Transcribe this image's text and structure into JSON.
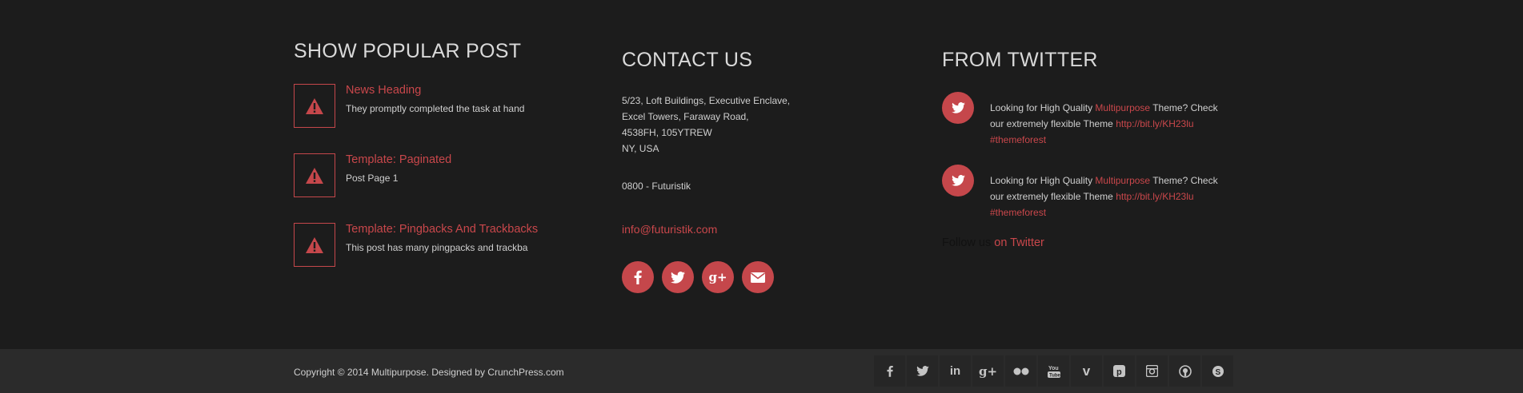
{
  "popular": {
    "title": "SHOW POPULAR POST",
    "posts": [
      {
        "title": "News Heading",
        "excerpt": "They promptly completed the task at hand"
      },
      {
        "title": "Template: Paginated",
        "excerpt": "Post Page 1"
      },
      {
        "title": "Template: Pingbacks And Trackbacks",
        "excerpt": "This post has many pingpacks and trackba"
      }
    ],
    "thumb_icon": "warning-icon"
  },
  "contact": {
    "title": "CONTACT US",
    "address": [
      "5/23, Loft Buildings, Executive Enclave,",
      "Excel Towers, Faraway Road,",
      "4538FH, 105YTREW",
      "NY, USA"
    ],
    "phone": "0800 - Futuristik",
    "email": "info@futuristik.com",
    "social_icons": [
      "facebook-icon",
      "twitter-icon",
      "google-plus-icon",
      "email-icon"
    ]
  },
  "twitter": {
    "title": "FROM TWITTER",
    "tweets": [
      {
        "pre": "Looking for High Quality ",
        "hl": "Multipurpose",
        "mid": " Theme? Check our extremely flexible Theme ",
        "link": "http://bit.ly/KH23lu",
        "tag": "#themeforest"
      },
      {
        "pre": "Looking for High Quality ",
        "hl": "Multipurpose",
        "mid": " Theme? Check our extremely flexible Theme ",
        "link": "http://bit.ly/KH23lu",
        "tag": "#themeforest"
      }
    ],
    "follow_prefix": "Follow us ",
    "follow_link": "on Twitter"
  },
  "bar": {
    "copyright": "Copyright © 2014 Multipurpose. Designed by CrunchPress.com",
    "icons": [
      "facebook-icon",
      "twitter-icon",
      "linkedin-icon",
      "google-plus-icon",
      "flickr-icon",
      "youtube-icon",
      "vimeo-icon",
      "pinterest-icon",
      "instagram-icon",
      "github-icon",
      "skype-icon"
    ]
  },
  "colors": {
    "accent": "#c5474b",
    "background": "#1c1c1c",
    "bar": "#2b2b2b"
  }
}
